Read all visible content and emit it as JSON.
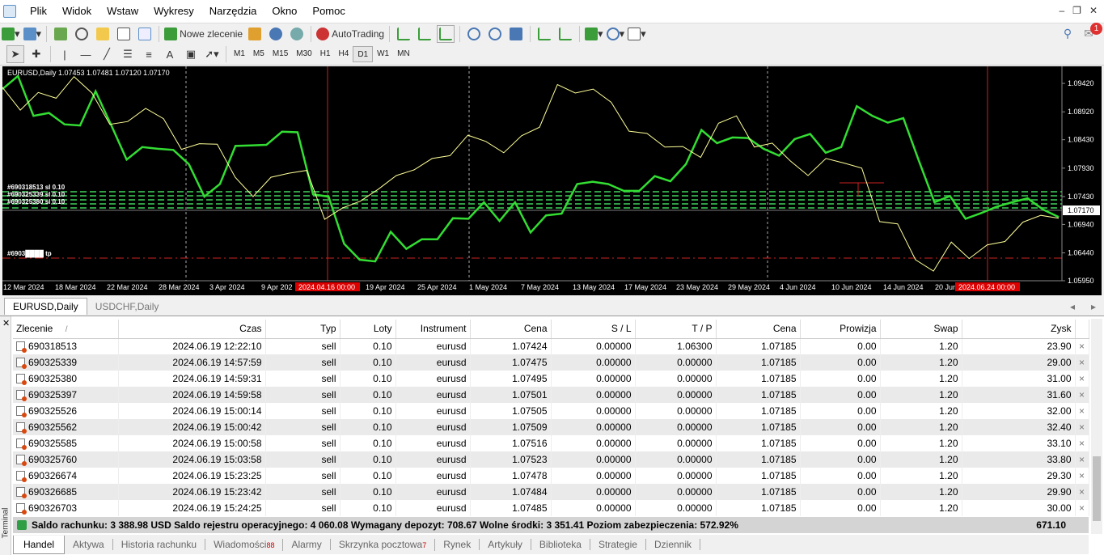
{
  "menu": {
    "items": [
      "Plik",
      "Widok",
      "Wstaw",
      "Wykresy",
      "Narzędzia",
      "Okno",
      "Pomoc"
    ]
  },
  "toolbar": {
    "new_order_label": "Nowe zlecenie",
    "autotrading_label": "AutoTrading",
    "notification_count": "1"
  },
  "timeframes": [
    "M1",
    "M5",
    "M15",
    "M30",
    "H1",
    "H4",
    "D1",
    "W1",
    "MN"
  ],
  "active_timeframe": "D1",
  "chart": {
    "title": "EURUSD,Daily  1.07453 1.07481 1.07120 1.07170",
    "current_price_label": "1.07170",
    "tp_label": "#6903████ tp",
    "orders_labels": [
      "#690318513 sl 0.10",
      "#690325339 sl 0.10",
      "#690325380 sl 0.10"
    ],
    "date_labels": [
      "12 Mar 2024",
      "18 Mar 2024",
      "22 Mar 2024",
      "28 Mar 2024",
      "3 Apr 2024",
      "9 Apr 202",
      "19 Apr 2024",
      "25 Apr 2024",
      "1 May 2024",
      "7 May 2024",
      "13 May 2024",
      "17 May 2024",
      "23 May 2024",
      "29 May 2024",
      "4 Jun 2024",
      "10 Jun 2024",
      "14 Jun 2024",
      "20 Jun"
    ],
    "highlight_dates": [
      "2024.04.16 00:00",
      "2024.06.24 00:00"
    ],
    "colors": {
      "green_line": "#33dd33",
      "yellow_line": "#ffff99",
      "red_line": "#cc2222",
      "background": "#000000"
    }
  },
  "chart_data": {
    "type": "line",
    "title": "EURUSD,Daily",
    "y_ticks": [
      "1.09420",
      "1.08920",
      "1.08430",
      "1.07930",
      "1.07430",
      "1.06940",
      "1.06440",
      "1.05950"
    ],
    "ylim": [
      1.0595,
      1.0972
    ],
    "series": [
      {
        "name": "",
        "values": [
          1.0932,
          1.0955,
          1.0885,
          1.089,
          1.087,
          1.0868,
          1.0928,
          1.0869,
          1.0808,
          1.083,
          1.0827,
          1.0825,
          1.08,
          1.0743,
          1.0765,
          1.0832,
          1.0833,
          1.0834,
          1.0857,
          1.0856,
          1.0747,
          1.0743,
          1.066,
          1.0632,
          1.0629,
          1.0681,
          1.0651,
          1.0668,
          1.0668,
          1.0705,
          1.0704,
          1.0733,
          1.07,
          1.0733,
          1.068,
          1.071,
          1.0713,
          1.0765,
          1.0769,
          1.0765,
          1.0753,
          1.0753,
          1.0779,
          1.077,
          1.08,
          1.086,
          1.0837,
          1.0847,
          1.0846,
          1.0827,
          1.0815,
          1.0844,
          1.0853,
          1.082,
          1.083,
          1.0902,
          1.0885,
          1.0873,
          1.0881,
          1.0806,
          1.0733,
          1.0744,
          1.0704,
          1.0714,
          1.0725,
          1.0733,
          1.074,
          1.072,
          1.0707
        ]
      },
      {
        "name": "",
        "values": [
          1.0935,
          1.0895,
          1.0926,
          1.0916,
          1.0954,
          1.0925,
          1.087,
          1.0875,
          1.0898,
          1.088,
          1.0826,
          1.0836,
          1.0835,
          1.0777,
          1.0743,
          1.0777,
          1.0784,
          1.0789,
          1.0703,
          1.0723,
          1.0735,
          1.0756,
          1.078,
          1.079,
          1.081,
          1.0815,
          1.0851,
          1.084,
          1.082,
          1.085,
          1.0865,
          1.094,
          1.0925,
          1.0932,
          1.0909,
          1.0858,
          1.0854,
          1.083,
          1.0831,
          1.0812,
          1.0872,
          1.0885,
          1.083,
          1.0837,
          1.0806,
          1.078,
          1.081,
          1.0802,
          1.0793,
          1.0699,
          1.0695,
          1.0632,
          1.0612,
          1.0663,
          1.0634,
          1.0658,
          1.0664,
          1.0698,
          1.071,
          1.0705
        ]
      }
    ]
  },
  "chart_tabs": [
    "EURUSD,Daily",
    "USDCHF,Daily"
  ],
  "table": {
    "headers": [
      "Zlecenie",
      "Czas",
      "Typ",
      "Loty",
      "Instrument",
      "Cena",
      "S / L",
      "T / P",
      "Cena",
      "Prowizja",
      "Swap",
      "Zysk"
    ],
    "sort_indicator": "/",
    "rows": [
      [
        "690318513",
        "2024.06.19 12:22:10",
        "sell",
        "0.10",
        "eurusd",
        "1.07424",
        "0.00000",
        "1.06300",
        "1.07185",
        "0.00",
        "1.20",
        "23.90"
      ],
      [
        "690325339",
        "2024.06.19 14:57:59",
        "sell",
        "0.10",
        "eurusd",
        "1.07475",
        "0.00000",
        "0.00000",
        "1.07185",
        "0.00",
        "1.20",
        "29.00"
      ],
      [
        "690325380",
        "2024.06.19 14:59:31",
        "sell",
        "0.10",
        "eurusd",
        "1.07495",
        "0.00000",
        "0.00000",
        "1.07185",
        "0.00",
        "1.20",
        "31.00"
      ],
      [
        "690325397",
        "2024.06.19 14:59:58",
        "sell",
        "0.10",
        "eurusd",
        "1.07501",
        "0.00000",
        "0.00000",
        "1.07185",
        "0.00",
        "1.20",
        "31.60"
      ],
      [
        "690325526",
        "2024.06.19 15:00:14",
        "sell",
        "0.10",
        "eurusd",
        "1.07505",
        "0.00000",
        "0.00000",
        "1.07185",
        "0.00",
        "1.20",
        "32.00"
      ],
      [
        "690325562",
        "2024.06.19 15:00:42",
        "sell",
        "0.10",
        "eurusd",
        "1.07509",
        "0.00000",
        "0.00000",
        "1.07185",
        "0.00",
        "1.20",
        "32.40"
      ],
      [
        "690325585",
        "2024.06.19 15:00:58",
        "sell",
        "0.10",
        "eurusd",
        "1.07516",
        "0.00000",
        "0.00000",
        "1.07185",
        "0.00",
        "1.20",
        "33.10"
      ],
      [
        "690325760",
        "2024.06.19 15:03:58",
        "sell",
        "0.10",
        "eurusd",
        "1.07523",
        "0.00000",
        "0.00000",
        "1.07185",
        "0.00",
        "1.20",
        "33.80"
      ],
      [
        "690326674",
        "2024.06.19 15:23:25",
        "sell",
        "0.10",
        "eurusd",
        "1.07478",
        "0.00000",
        "0.00000",
        "1.07185",
        "0.00",
        "1.20",
        "29.30"
      ],
      [
        "690326685",
        "2024.06.19 15:23:42",
        "sell",
        "0.10",
        "eurusd",
        "1.07484",
        "0.00000",
        "0.00000",
        "1.07185",
        "0.00",
        "1.20",
        "29.90"
      ],
      [
        "690326703",
        "2024.06.19 15:24:25",
        "sell",
        "0.10",
        "eurusd",
        "1.07485",
        "0.00000",
        "0.00000",
        "1.07185",
        "0.00",
        "1.20",
        "30.00"
      ]
    ]
  },
  "summary": {
    "text": "Saldo rachunku: 3 388.98 USD  Saldo rejestru operacyjnego: 4 060.08  Wymagany depozyt: 708.67  Wolne środki: 3 351.41  Poziom zabezpieczenia: 572.92%",
    "total": "671.10"
  },
  "terminal": {
    "side_label": "Terminal",
    "tabs": [
      {
        "label": "Handel",
        "badge": ""
      },
      {
        "label": "Aktywa",
        "badge": ""
      },
      {
        "label": "Historia rachunku",
        "badge": ""
      },
      {
        "label": "Wiadomości",
        "badge": "88"
      },
      {
        "label": "Alarmy",
        "badge": ""
      },
      {
        "label": "Skrzynka pocztowa",
        "badge": "7"
      },
      {
        "label": "Rynek",
        "badge": ""
      },
      {
        "label": "Artykuły",
        "badge": ""
      },
      {
        "label": "Biblioteka",
        "badge": ""
      },
      {
        "label": "Strategie",
        "badge": ""
      },
      {
        "label": "Dziennik",
        "badge": ""
      }
    ]
  }
}
